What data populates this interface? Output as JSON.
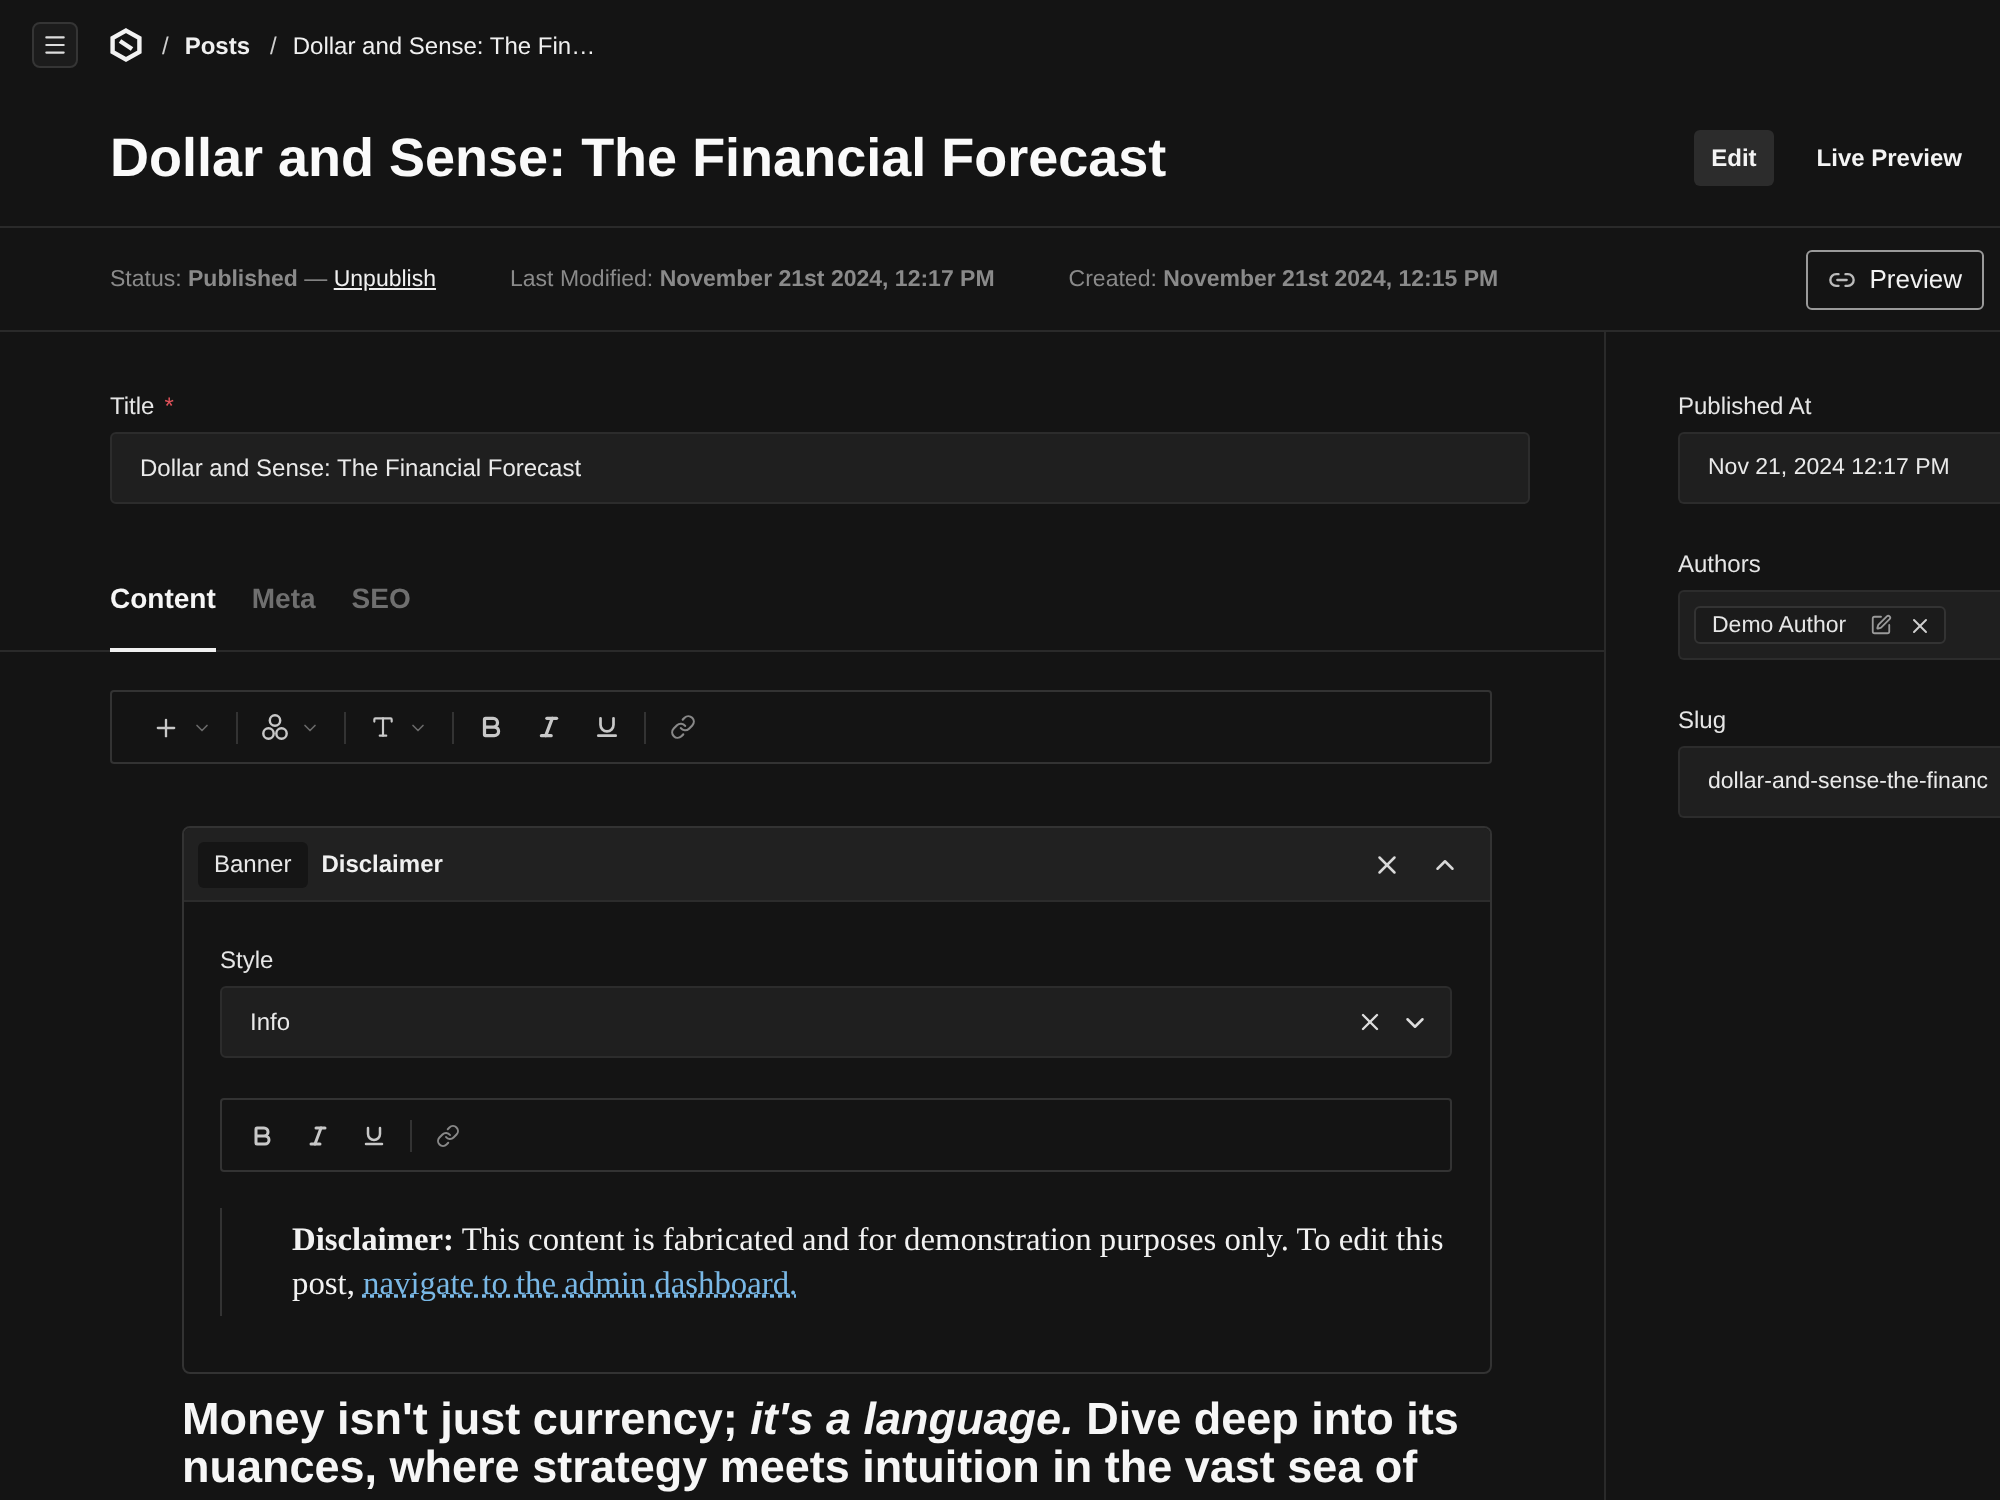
{
  "header": {
    "breadcrumbs": [
      {
        "separator": "/",
        "label": "Posts"
      },
      {
        "separator": "/",
        "label": "Dollar and Sense: The Fin…"
      }
    ]
  },
  "document": {
    "title": "Dollar and Sense: The Financial Forecast",
    "view_tabs": [
      {
        "label": "Edit",
        "selected": true
      },
      {
        "label": "Live Preview",
        "selected": false
      }
    ]
  },
  "meta": {
    "status": {
      "text": "Status: **Published** —",
      "link": "Unpublish"
    },
    "dates": [
      "Last Modified: **November 21st 2024, 12:17 PM**",
      "Created: **November 21st 2024, 12:15 PM**"
    ],
    "preview_button": "Preview"
  },
  "form": {
    "title_field": {
      "label": "Title",
      "required_mark": "*",
      "value": "Dollar and Sense: The Financial Forecast"
    },
    "tabs": [
      {
        "label": "Content",
        "selected": true
      },
      {
        "label": "Meta",
        "selected": false
      },
      {
        "label": "SEO",
        "selected": false
      }
    ],
    "block": {
      "type": "Banner",
      "name": "Disclaimer",
      "expanded": true,
      "style_field": {
        "label": "Style",
        "value": "Info"
      },
      "text": "**Disclaimer:** This content is fabricated and for demonstration purposes only. To edit this post,",
      "link": "navigate to the admin dashboard."
    },
    "body": "Money isn't just currency; *it's a language.* Dive deep into its nuances, where strategy meets intuition in the vast sea of"
  },
  "sidebar": {
    "fields": [
      {
        "kind": "date",
        "label": "Published At",
        "value": "Nov 21, 2024 12:17 PM"
      },
      {
        "kind": "relationship",
        "label": "Authors",
        "chips": [
          {
            "label": "Demo Author"
          }
        ]
      },
      {
        "kind": "text",
        "label": "Slug",
        "value": "dollar-and-sense-the-financ"
      }
    ]
  }
}
